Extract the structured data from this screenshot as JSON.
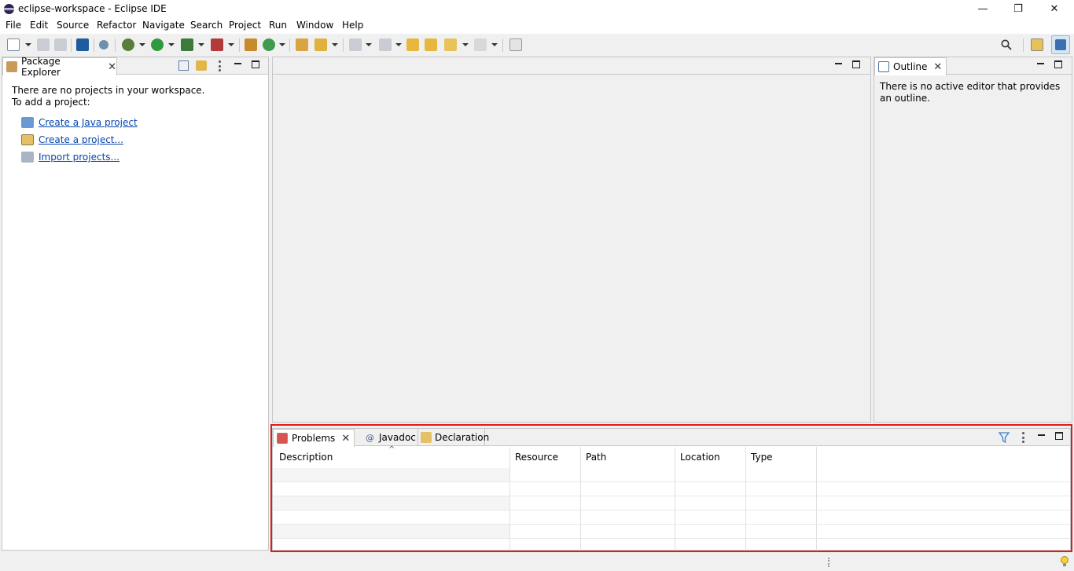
{
  "window": {
    "title": "eclipse-workspace - Eclipse IDE",
    "minimize": "—",
    "restore": "❐",
    "close": "✕"
  },
  "menu": [
    "File",
    "Edit",
    "Source",
    "Refactor",
    "Navigate",
    "Search",
    "Project",
    "Run",
    "Window",
    "Help"
  ],
  "package_explorer": {
    "tab_label": "Package Explorer",
    "message_line1": "There are no projects in your workspace.",
    "message_line2": "To add a project:",
    "links": [
      "Create a Java project",
      "Create a project...",
      "Import projects..."
    ]
  },
  "outline": {
    "tab_label": "Outline",
    "message": "There is no active editor that provides an outline."
  },
  "bottom_panel": {
    "tabs": [
      "Problems",
      "Javadoc",
      "Declaration"
    ],
    "columns": [
      "Description",
      "Resource",
      "Path",
      "Location",
      "Type"
    ],
    "sort_indicator": "^"
  },
  "icons": {
    "close": "✕",
    "search": "search-icon",
    "filter": "filter-icon",
    "lightbulb": "lightbulb-icon"
  },
  "colors": {
    "highlight": "#e01b1b",
    "link": "#0645ad",
    "eclipse_purple": "#2c2255"
  }
}
